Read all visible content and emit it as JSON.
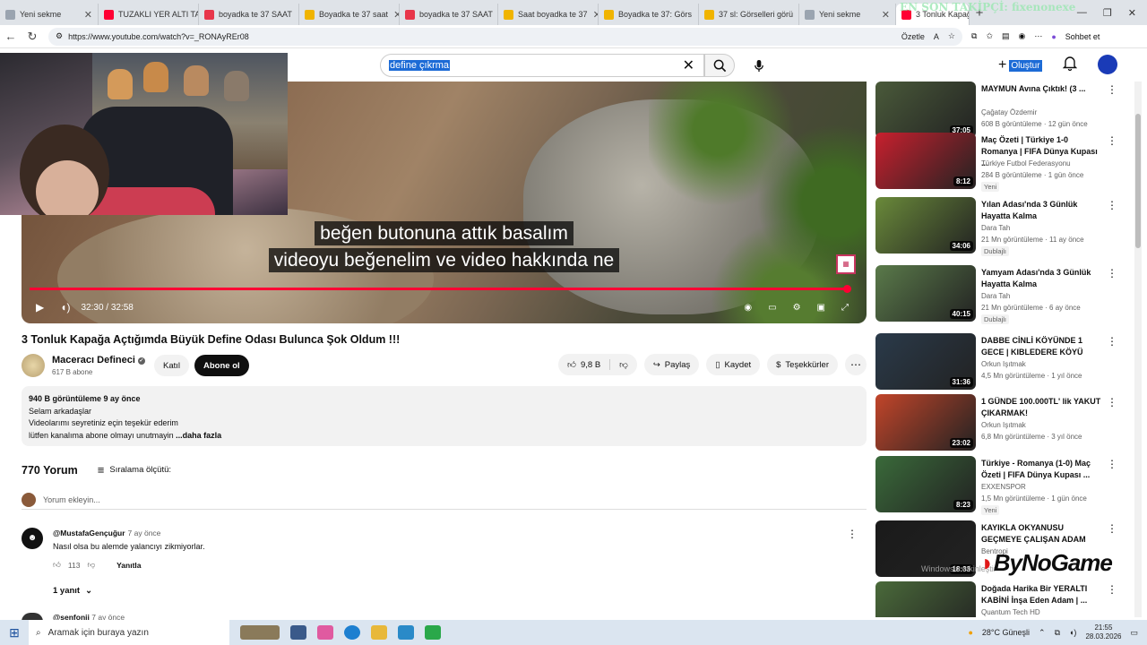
{
  "browser": {
    "tabs": [
      {
        "label": "Yeni sekme",
        "color": "#9aa4b0",
        "active": false
      },
      {
        "label": "TUZAKLI YER ALTI TA",
        "color": "#ff0033",
        "active": false
      },
      {
        "label": "boyadka te 37 SAAT",
        "color": "#e8364a",
        "active": false
      },
      {
        "label": "Boyadka te 37 saat",
        "color": "#f0b400",
        "active": false
      },
      {
        "label": "boyadka te 37 SAAT",
        "color": "#e8364a",
        "active": false
      },
      {
        "label": "Saat boyadka te 37",
        "color": "#f0b400",
        "active": false
      },
      {
        "label": "Boyadka te 37: Görs",
        "color": "#f0b400",
        "active": false
      },
      {
        "label": "37 sl: Görselleri görü",
        "color": "#f0b400",
        "active": false
      },
      {
        "label": "Yeni sekme",
        "color": "#9aa4b0",
        "active": false
      },
      {
        "label": "3 Tonluk Kapağa Aç",
        "color": "#ff0033",
        "active": true
      }
    ],
    "overlay_text": "EN SON TAKİPÇİ: fixenonexe",
    "url": "https://www.youtube.com/watch?v=_RONAyREr08",
    "summarize_label": "Özetle",
    "chat_label": "Sohbet et"
  },
  "youtube": {
    "search_query": "define çıkrma",
    "create_label": "Oluştur"
  },
  "player": {
    "subtitle_line1": "beğen butonuna attık basalım",
    "subtitle_line2": "videoyu beğenelim ve video hakkında ne",
    "time": "32:30 / 32:58",
    "progress_fraction": 0.987
  },
  "video": {
    "title": "3 Tonluk Kapağa Açtığımda Büyük Define Odası Bulunca Şok Oldum !!!",
    "channel": "Maceracı Defineci",
    "subscribers": "617 B abone",
    "join_label": "Katıl",
    "subscribe_label": "Abone ol",
    "likes": "9,8 B",
    "share_label": "Paylaş",
    "save_label": "Kaydet",
    "thanks_label": "Teşekkürler",
    "description": {
      "meta": "940 B görüntüleme  9 ay önce",
      "line1": "Selam arkadaşlar",
      "line2": "Videolarımı seyretiniz eçin teşekür ederim",
      "line3": "lütfen kanalıma abone olmayı unutmayin",
      "more": "...daha fazla"
    }
  },
  "comments": {
    "count_label": "770 Yorum",
    "sort_label": "Sıralama ölçütü:",
    "add_placeholder": "Yorum ekleyin...",
    "first": {
      "user": "@MustafaGençuğur",
      "when": "7 ay önce",
      "text": "Nasıl olsa bu alemde yalancıyı zikmiyorlar.",
      "likes": "113",
      "reply_label": "Yanıtla",
      "replies_label": "1 yanıt"
    },
    "second": {
      "user": "@senfonii",
      "when": "7 ay önce"
    }
  },
  "sidebar": [
    {
      "title": "MAYMUN Avına Çıktık! (3 ...",
      "channel": "Çağatay Özdemir",
      "meta": "608 B görüntüleme · 12 gün önce",
      "duration": "37:05",
      "thumb": "#4a5a3a",
      "badge": ""
    },
    {
      "title": "Maç Özeti | Türkiye 1-0 Romanya | FIFA Dünya Kupası ...",
      "channel": "Türkiye Futbol Federasyonu",
      "meta": "284 B görüntüleme · 1 gün önce",
      "duration": "8:12",
      "thumb": "#c8202e",
      "badge": "Yeni"
    },
    {
      "title": "Yılan Adası'nda 3 Günlük Hayatta Kalma",
      "channel": "Dara Tah",
      "meta": "21 Mn görüntüleme · 11 ay önce",
      "duration": "34:06",
      "thumb": "#6a8a3a",
      "badge": "Dublajlı"
    },
    {
      "title": "Yamyam Adası'nda 3 Günlük Hayatta Kalma",
      "channel": "Dara Tah",
      "meta": "21 Mn görüntüleme · 6 ay önce",
      "duration": "40:15",
      "thumb": "#5a7a4a",
      "badge": "Dublajlı"
    },
    {
      "title": "DABBE CİNLİ KÖYÜNDE 1 GECE | KIBLEDERE KÖYÜ",
      "channel": "Orkun Işıtmak",
      "meta": "4,5 Mn görüntüleme · 1 yıl önce",
      "duration": "31:36",
      "thumb": "#2a3a4a",
      "badge": ""
    },
    {
      "title": "1 GÜNDE 100.000TL' lik YAKUT ÇIKARMAK!",
      "channel": "Orkun Işıtmak",
      "meta": "6,8 Mn görüntüleme · 3 yıl önce",
      "duration": "23:02",
      "thumb": "#c2452a",
      "badge": ""
    },
    {
      "title": "Türkiye - Romanya (1-0) Maç Özeti | FIFA Dünya Kupası ...",
      "channel": "EXXENSPOR",
      "meta": "1,5 Mn görüntüleme · 1 gün önce",
      "duration": "8:23",
      "thumb": "#3a6a3a",
      "badge": "Yeni"
    },
    {
      "title": "KAYIKLA OKYANUSU GEÇMEYE ÇALIŞAN ADAM",
      "channel": "Bentropi",
      "meta": "",
      "duration": "18:33",
      "thumb": "#1a1a1a",
      "badge": ""
    },
    {
      "title": "Doğada Harika Bir YERALTI KABİNİ İnşa Eden Adam | ...",
      "channel": "Quantum Tech HD",
      "meta": "",
      "duration": "",
      "thumb": "#4a6a3a",
      "badge": ""
    }
  ],
  "watermark": {
    "brand": "ByNoGame",
    "windows": "Windows'u etkinleştir"
  },
  "taskbar": {
    "search_placeholder": "Aramak için buraya yazın",
    "weather": "28°C  Güneşli",
    "time": "21:55",
    "date": "28.03.2026"
  }
}
